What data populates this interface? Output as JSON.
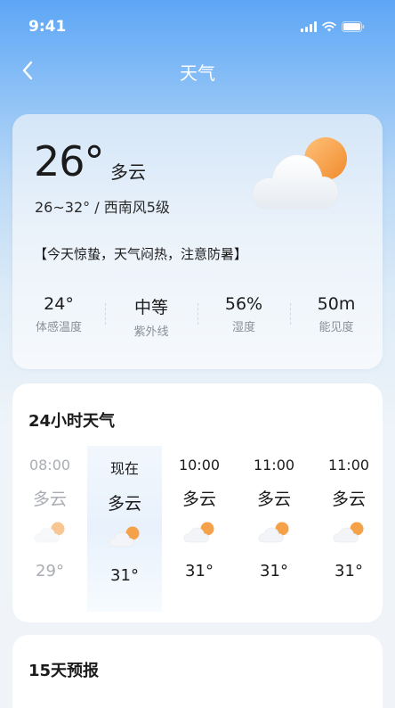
{
  "status_bar": {
    "time": "9:41"
  },
  "nav": {
    "title": "天气"
  },
  "current": {
    "temp": "26°",
    "condition": "多云",
    "range_wind": "26~32° / 西南风5级",
    "tip": "【今天惊蛰，天气闷热，注意防暑】",
    "stats": [
      {
        "value": "24°",
        "label": "体感温度"
      },
      {
        "value": "中等",
        "label": "紫外线"
      },
      {
        "value": "56%",
        "label": "湿度"
      },
      {
        "value": "50m",
        "label": "能见度"
      }
    ]
  },
  "hourly": {
    "title": "24小时天气",
    "items": [
      {
        "time": "08:00",
        "condition": "多云",
        "temp": "29°"
      },
      {
        "time": "现在",
        "condition": "多云",
        "temp": "31°"
      },
      {
        "time": "10:00",
        "condition": "多云",
        "temp": "31°"
      },
      {
        "time": "11:00",
        "condition": "多云",
        "temp": "31°"
      },
      {
        "time": "11:00",
        "condition": "多云",
        "temp": "31°"
      }
    ]
  },
  "forecast": {
    "title": "15天预报"
  },
  "colors": {
    "sun": "#f5a14a",
    "accent_bg": "#5da6f5"
  }
}
